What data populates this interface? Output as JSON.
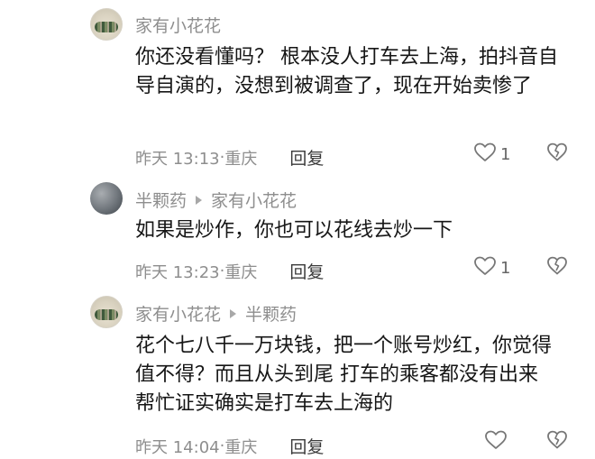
{
  "comments": [
    {
      "author": "家有小花花",
      "reply_to": "",
      "text": "你还没看懂吗？ 根本没人打车去上海，拍抖音自导自演的，没想到被调查了，现在开始卖惨了",
      "time": "昨天 13:13",
      "location": "重庆",
      "reply_label": "回复",
      "likes": "1",
      "avatar_icon": "flower-photo-avatar",
      "like_icon": "heart-outline-icon",
      "dislike_icon": "broken-heart-icon"
    },
    {
      "author": "半颗药",
      "reply_to": "家有小花花",
      "text": "如果是炒作，你也可以花线去炒一下",
      "time": "昨天 13:23",
      "location": "重庆",
      "reply_label": "回复",
      "likes": "1",
      "avatar_icon": "gray-photo-avatar",
      "like_icon": "heart-outline-icon",
      "dislike_icon": "broken-heart-icon"
    },
    {
      "author": "家有小花花",
      "reply_to": "半颗药",
      "text": "花个七八千一万块钱，把一个账号炒红，你觉得值不得？而且从头到尾 打车的乘客都没有出来帮忙证实确实是打车去上海的",
      "time": "昨天 14:04",
      "location": "重庆",
      "reply_label": "回复",
      "likes": "",
      "avatar_icon": "flower-photo-avatar",
      "like_icon": "heart-outline-icon",
      "dislike_icon": "broken-heart-icon"
    }
  ],
  "separator": "·",
  "colors": {
    "meta": "#8e8e8e",
    "text": "#161616"
  }
}
